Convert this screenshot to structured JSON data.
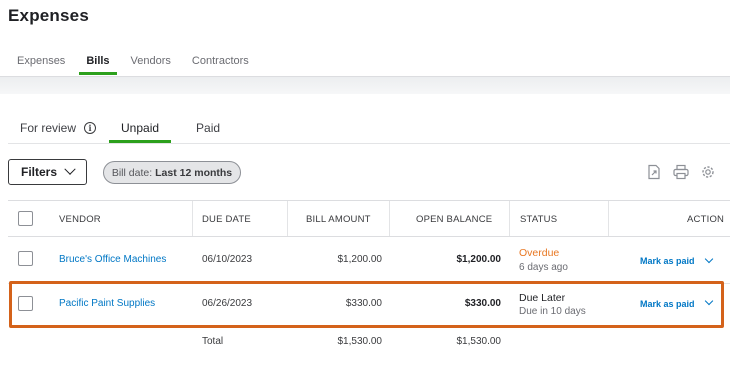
{
  "page": {
    "title": "Expenses"
  },
  "top_tabs": [
    {
      "label": "Expenses",
      "active": false
    },
    {
      "label": "Bills",
      "active": true
    },
    {
      "label": "Vendors",
      "active": false
    },
    {
      "label": "Contractors",
      "active": false
    }
  ],
  "sub_tabs": {
    "review": "For review",
    "unpaid": "Unpaid",
    "paid": "Paid",
    "active": "Unpaid"
  },
  "filters": {
    "button_label": "Filters",
    "chip_prefix": "Bill date:",
    "chip_value": "Last 12 months"
  },
  "toolbar_icons": [
    "export-icon",
    "print-icon",
    "settings-gear-icon"
  ],
  "table": {
    "headers": {
      "vendor": "VENDOR",
      "due_date": "DUE DATE",
      "bill_amount": "BILL AMOUNT",
      "open_balance": "OPEN BALANCE",
      "status": "STATUS",
      "action": "ACTION"
    },
    "rows": [
      {
        "vendor": "Bruce's Office Machines",
        "due_date": "06/10/2023",
        "bill_amount": "$1,200.00",
        "open_balance": "$1,200.00",
        "status": "Overdue",
        "status_sub": "6 days ago",
        "action": "Mark as paid"
      },
      {
        "vendor": "Pacific Paint Supplies",
        "due_date": "06/26/2023",
        "bill_amount": "$330.00",
        "open_balance": "$330.00",
        "status": "Due Later",
        "status_sub": "Due in 10 days",
        "action": "Mark as paid"
      }
    ],
    "total": {
      "label": "Total",
      "bill_amount": "$1,530.00",
      "open_balance": "$1,530.00"
    }
  },
  "colors": {
    "accent_green": "#2ca01c",
    "link_blue": "#0077c5",
    "overdue_orange": "#e87722",
    "highlight_border": "#d4621a"
  }
}
